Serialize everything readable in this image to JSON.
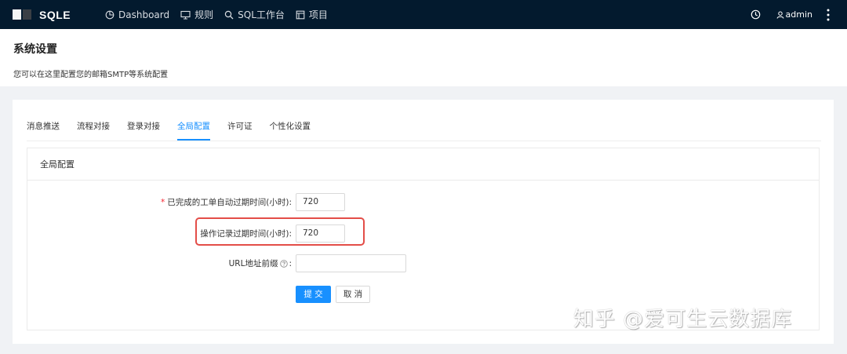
{
  "app": {
    "name": "SQLE"
  },
  "nav": [
    {
      "label": "Dashboard",
      "icon": "pie-chart-icon"
    },
    {
      "label": "规则",
      "icon": "monitor-icon"
    },
    {
      "label": "SQL工作台",
      "icon": "search-icon"
    },
    {
      "label": "项目",
      "icon": "project-icon"
    }
  ],
  "user": {
    "name": "admin"
  },
  "page": {
    "title": "系统设置",
    "description": "您可以在这里配置您的邮箱SMTP等系统配置"
  },
  "tabs": [
    "消息推送",
    "流程对接",
    "登录对接",
    "全局配置",
    "许可证",
    "个性化设置"
  ],
  "active_tab": "全局配置",
  "section": {
    "title": "全局配置"
  },
  "form": {
    "fields": [
      {
        "label": "已完成的工单自动过期时间(小时)",
        "required": true,
        "value": "720"
      },
      {
        "label": "操作记录过期时间(小时)",
        "required": false,
        "value": "720"
      },
      {
        "label": "URL地址前缀",
        "required": false,
        "value": "",
        "help": true
      }
    ],
    "colon": ":",
    "submit_label": "提 交",
    "cancel_label": "取 消"
  },
  "watermark": "知乎 @爱可生云数据库",
  "colors": {
    "topbar": "#031a2e",
    "accent": "#1890ff",
    "highlight": "#e34d48",
    "required": "#f5222d"
  }
}
